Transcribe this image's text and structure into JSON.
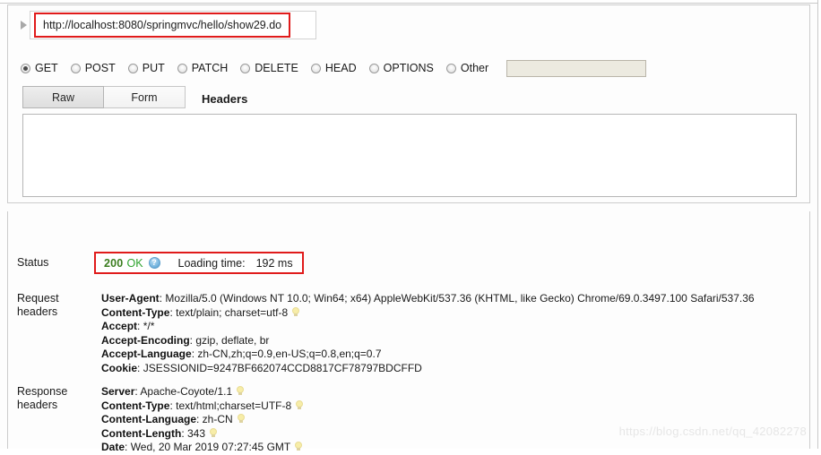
{
  "request": {
    "url_value": "http://localhost:8080/springmvc/hello/show29.do",
    "url_placeholder": "http://",
    "disclosure_icon": "triangle-right-icon",
    "methods": [
      {
        "label": "GET",
        "checked": true
      },
      {
        "label": "POST",
        "checked": false
      },
      {
        "label": "PUT",
        "checked": false
      },
      {
        "label": "PATCH",
        "checked": false
      },
      {
        "label": "DELETE",
        "checked": false
      },
      {
        "label": "HEAD",
        "checked": false
      },
      {
        "label": "OPTIONS",
        "checked": false
      },
      {
        "label": "Other",
        "checked": false
      }
    ],
    "other_method_value": "",
    "other_method_placeholder": "",
    "tabs": [
      {
        "label": "Raw",
        "active": true
      },
      {
        "label": "Form",
        "active": false
      }
    ],
    "headers_title": "Headers",
    "body_value": "",
    "body_placeholder": ""
  },
  "response": {
    "status_label": "Status",
    "status_code": "200",
    "status_text": "OK",
    "help_icon": "question-mark-icon",
    "help_glyph": "?",
    "loading_time_label": "Loading time:",
    "loading_time_value": "192 ms",
    "request_headers_label_line1": "Request",
    "request_headers_label_line2": "headers",
    "request_headers": [
      {
        "name": "User-Agent",
        "value": "Mozilla/5.0 (Windows NT 10.0; Win64; x64) AppleWebKit/537.36 (KHTML, like Gecko) Chrome/69.0.3497.100 Safari/537.36",
        "bulb": false
      },
      {
        "name": "Content-Type",
        "value": "text/plain; charset=utf-8",
        "bulb": true
      },
      {
        "name": "Accept",
        "value": "*/*",
        "bulb": false
      },
      {
        "name": "Accept-Encoding",
        "value": "gzip, deflate, br",
        "bulb": false
      },
      {
        "name": "Accept-Language",
        "value": "zh-CN,zh;q=0.9,en-US;q=0.8,en;q=0.7",
        "bulb": false
      },
      {
        "name": "Cookie",
        "value": "JSESSIONID=9247BF662074CCD8817CF78797BDCFFD",
        "bulb": false
      }
    ],
    "response_headers_label_line1": "Response",
    "response_headers_label_line2": "headers",
    "response_headers": [
      {
        "name": "Server",
        "value": "Apache-Coyote/1.1",
        "bulb": true
      },
      {
        "name": "Content-Type",
        "value": "text/html;charset=UTF-8",
        "bulb": true
      },
      {
        "name": "Content-Language",
        "value": "zh-CN",
        "bulb": true
      },
      {
        "name": "Content-Length",
        "value": "343",
        "bulb": true
      },
      {
        "name": "Date",
        "value": "Wed, 20 Mar 2019 07:27:45 GMT",
        "bulb": true
      }
    ]
  },
  "watermark": {
    "text": "https://blog.csdn.net/qq_42082278"
  },
  "colors": {
    "highlight_border": "#e01b1b",
    "status_code": "#3b7d1f",
    "status_ok": "#2ea32e",
    "panel_border": "#cccccc"
  }
}
